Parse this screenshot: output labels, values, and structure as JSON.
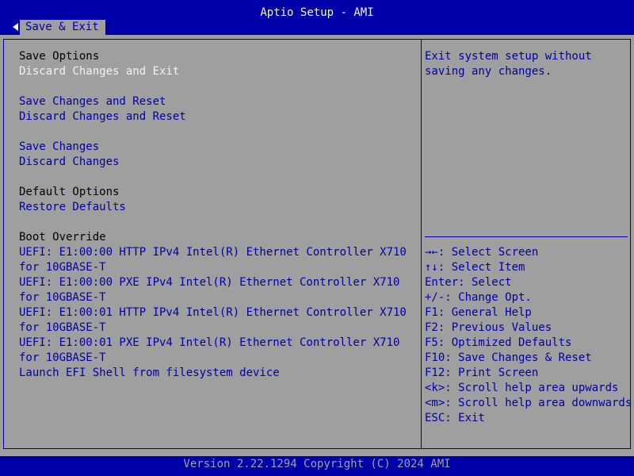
{
  "header": {
    "title": "Aptio Setup - AMI",
    "tab_label": "Save & Exit"
  },
  "left_panel": {
    "save_options_heading": "Save Options",
    "discard_changes_and_exit": "Discard Changes and Exit",
    "save_changes_and_reset": "Save Changes and Reset",
    "discard_changes_and_reset": "Discard Changes and Reset",
    "save_changes": "Save Changes",
    "discard_changes": "Discard Changes",
    "default_options_heading": "Default Options",
    "restore_defaults": "Restore Defaults",
    "boot_override_heading": "Boot Override",
    "boot_entries": [
      {
        "line1": "UEFI: E1:00:00 HTTP IPv4 Intel(R) Ethernet Controller X710",
        "line2": "for 10GBASE-T"
      },
      {
        "line1": "UEFI: E1:00:00 PXE IPv4 Intel(R) Ethernet Controller X710",
        "line2": "for 10GBASE-T"
      },
      {
        "line1": "UEFI: E1:00:01 HTTP IPv4 Intel(R) Ethernet Controller X710",
        "line2": "for 10GBASE-T"
      },
      {
        "line1": "UEFI: E1:00:01 PXE IPv4 Intel(R) Ethernet Controller X710",
        "line2": "for 10GBASE-T"
      }
    ],
    "launch_efi_shell": "Launch EFI Shell from filesystem device"
  },
  "help_panel": {
    "line1": "Exit system setup without",
    "line2": "saving any changes."
  },
  "key_help": [
    "→←: Select Screen",
    "↑↓: Select Item",
    "Enter: Select",
    "+/-: Change Opt.",
    "F1: General Help",
    "F2: Previous Values",
    "F5: Optimized Defaults",
    "F10: Save Changes & Reset",
    "F12: Print Screen",
    "<k>: Scroll help area upwards",
    "<m>: Scroll help area downwards",
    "ESC: Exit"
  ],
  "footer": {
    "version": "Version 2.22.1294 Copyright (C) 2024 AMI"
  },
  "colors": {
    "background": "#9f9f9f",
    "bar": "#0000a8",
    "selected_text": "#f2f2f2",
    "heading_text": "#000000",
    "option_text": "#0000a8"
  }
}
